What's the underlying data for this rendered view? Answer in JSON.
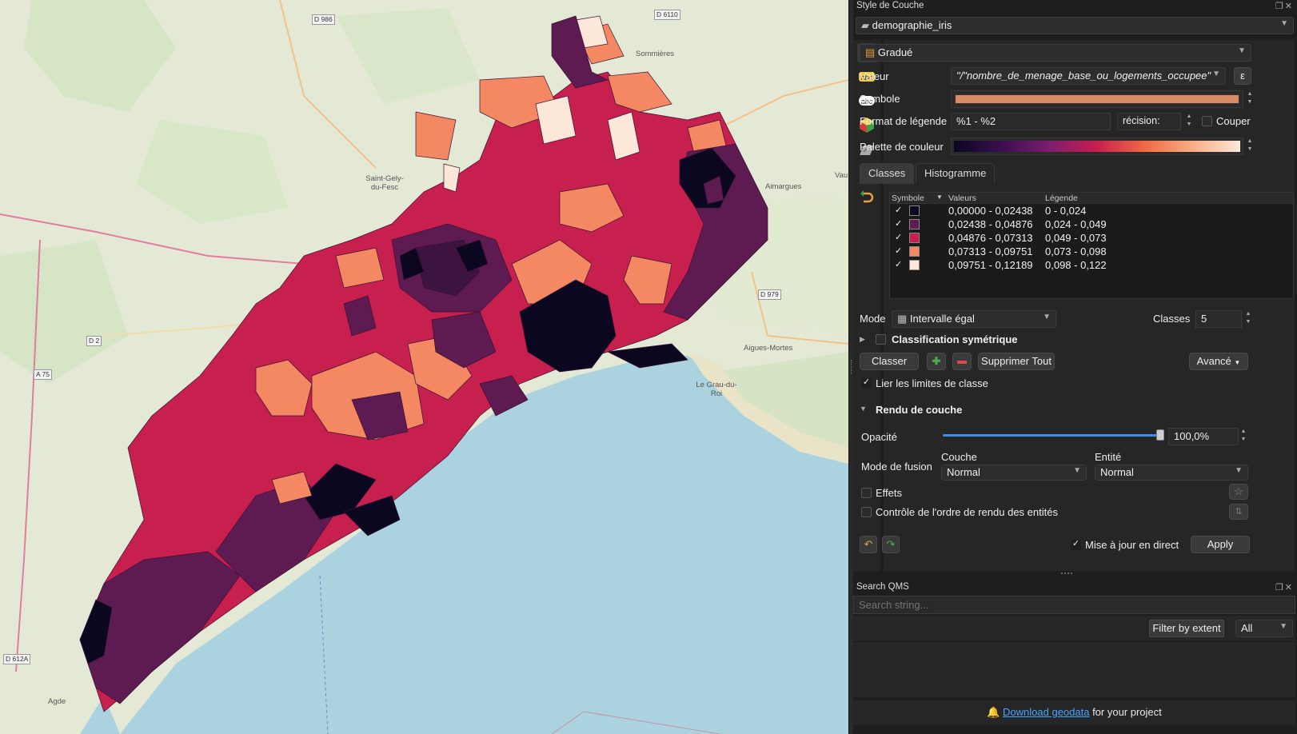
{
  "map": {
    "places": [
      {
        "text": "Sommières"
      },
      {
        "text": "Saint-Gely-\ndu-Fesc"
      },
      {
        "text": "Aimargues"
      },
      {
        "text": "Aigues-Mortes"
      },
      {
        "text": "Le Grau-du-\nRoi"
      },
      {
        "text": "Agde"
      },
      {
        "text": "Vau"
      }
    ],
    "roads": [
      "D 986",
      "D 6110",
      "D 979",
      "D 2",
      "A 75",
      "D 612A"
    ],
    "colors": {
      "class1": "#0b0720",
      "class2": "#5e1b52",
      "class3": "#c71f4e",
      "class4": "#f48862",
      "class5": "#fde7d8",
      "sea": "#aad3df",
      "land": "#e6ead8"
    }
  },
  "style_panel": {
    "dock_title": "Style de Couche",
    "layer_name": "demographie_iris",
    "renderer": "Gradué",
    "value_label": "Valeur",
    "value_expr": "\"/\"nombre_de_menage_base_ou_logements_occupee\"",
    "symbol_label": "Symbole",
    "legend_format_label": "Format de légende",
    "legend_format_value": "%1 - %2",
    "precision_label": "récision:",
    "trim_label": "Couper",
    "palette_label": "Palette de couleur",
    "tabs": [
      "Classes",
      "Histogramme"
    ],
    "table_headers": {
      "symbol": "Symbole",
      "values": "Valeurs",
      "legend": "Légende"
    },
    "classes": [
      {
        "check": "✓",
        "color": "#0b0720",
        "values": "0,00000 - 0,02438",
        "legend": "0 - 0,024"
      },
      {
        "check": "✓",
        "color": "#5e1b52",
        "values": "0,02438 - 0,04876",
        "legend": "0,024 - 0,049"
      },
      {
        "check": "✓",
        "color": "#c71f4e",
        "values": "0,04876 - 0,07313",
        "legend": "0,049 - 0,073"
      },
      {
        "check": "✓",
        "color": "#f48862",
        "values": "0,07313 - 0,09751",
        "legend": "0,073 - 0,098"
      },
      {
        "check": "✓",
        "color": "#fde7d8",
        "values": "0,09751 - 0,12189",
        "legend": "0,098 - 0,122"
      }
    ],
    "mode_label": "Mode",
    "mode_value": "Intervalle égal",
    "classes_label": "Classes",
    "classes_count": "5",
    "symmetric_label": "Classification symétrique",
    "classify_button": "Classer",
    "delete_all_button": "Supprimer Tout",
    "advanced_button": "Avancé",
    "link_bounds_label": "Lier les limites de classe",
    "layer_render_section": "Rendu de couche",
    "opacity_label": "Opacité",
    "opacity_value": "100,0%",
    "opacity_fraction": 1.0,
    "blend_mode_label": "Mode de fusion",
    "blend_layer_label": "Couche",
    "blend_feature_label": "Entité",
    "blend_layer_value": "Normal",
    "blend_feature_value": "Normal",
    "effects_label": "Effets",
    "render_order_label": "Contrôle de l'ordre de rendu des entités",
    "live_update_label": "Mise à jour en direct",
    "apply_button": "Apply",
    "check_mark": "✓"
  },
  "qms_panel": {
    "dock_title": "Search QMS",
    "search_placeholder": "Search string...",
    "filter_button": "Filter by extent",
    "filter_value": "All",
    "download_link": "Download geodata",
    "download_suffix": " for your project"
  }
}
